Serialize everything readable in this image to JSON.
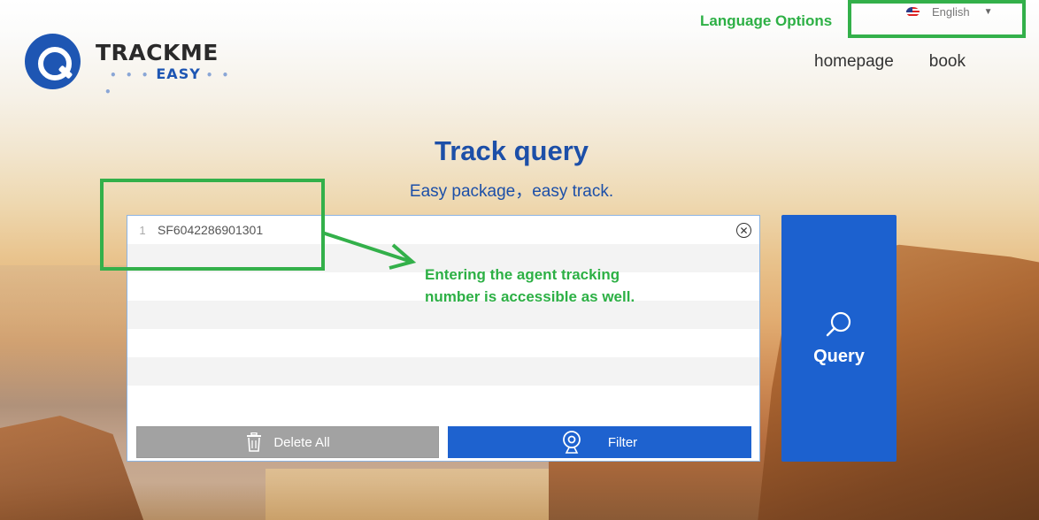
{
  "brand": {
    "name": "TRACKME",
    "sub": "EASY",
    "dots": "• • •"
  },
  "language": {
    "annotation_label": "Language Options",
    "selected": "English",
    "flag_icon": "us-flag-icon",
    "caret_icon": "caret-down-icon"
  },
  "nav": {
    "items": [
      "homepage",
      "book"
    ]
  },
  "hero": {
    "title": "Track query",
    "subtitle": "Easy package，easy track."
  },
  "input": {
    "lines": [
      {
        "num": "1",
        "text": "SF6042286901301"
      },
      {
        "num": "",
        "text": ""
      },
      {
        "num": "",
        "text": ""
      },
      {
        "num": "",
        "text": ""
      },
      {
        "num": "",
        "text": ""
      },
      {
        "num": "",
        "text": ""
      },
      {
        "num": "",
        "text": ""
      }
    ],
    "clear_icon": "close-circle-icon",
    "delete_label": "Delete All",
    "filter_label": "Filter"
  },
  "query": {
    "label": "Query",
    "icon": "search-icon"
  },
  "annotation": {
    "text": "Entering the agent tracking number is accessible as well."
  },
  "colors": {
    "accent": "#1c61cf",
    "highlight": "#33b04a",
    "title": "#1c4fa8"
  }
}
